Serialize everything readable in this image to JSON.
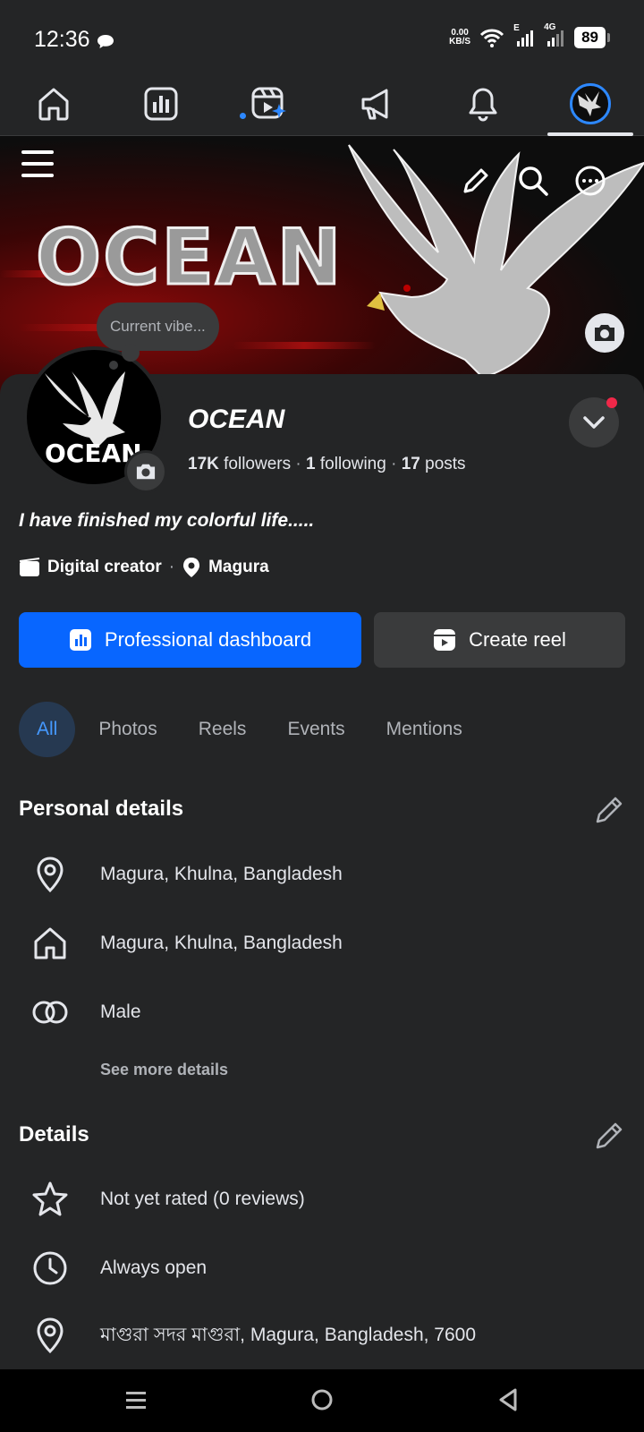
{
  "status_bar": {
    "time": "12:36",
    "net_speed_top": "0.00",
    "net_speed_bottom": "KB/S",
    "network_e": "E",
    "network_4g": "4G",
    "battery": "89"
  },
  "top_nav": {
    "items": [
      "home-icon",
      "dashboard-icon",
      "reels-icon",
      "megaphone-icon",
      "bell-icon",
      "profile-avatar"
    ],
    "active": "profile-avatar"
  },
  "cover": {
    "title": "OCEAN"
  },
  "status_bubble": "Current vibe...",
  "profile": {
    "avatar_text": "OCEAN",
    "name": "OCEAN",
    "followers_count": "17K",
    "followers_label": "followers",
    "following_count": "1",
    "following_label": "following",
    "posts_count": "17",
    "posts_label": "posts",
    "bio": "I have finished my colorful life.....",
    "category": "Digital creator",
    "location": "Magura"
  },
  "actions": {
    "primary": "Professional dashboard",
    "secondary": "Create reel"
  },
  "filters": [
    "All",
    "Photos",
    "Reels",
    "Events",
    "Mentions"
  ],
  "active_filter": "All",
  "personal_details": {
    "title": "Personal details",
    "rows": [
      {
        "icon": "location-pin-icon",
        "text": "Magura, Khulna, Bangladesh"
      },
      {
        "icon": "home-icon",
        "text": "Magura, Khulna, Bangladesh"
      },
      {
        "icon": "gender-icon",
        "text": "Male"
      }
    ],
    "see_more": "See more details"
  },
  "details": {
    "title": "Details",
    "rows": [
      {
        "icon": "star-icon",
        "text": "Not yet rated (0 reviews)"
      },
      {
        "icon": "clock-icon",
        "text": "Always open"
      },
      {
        "icon": "location-pin-icon",
        "text": "মাগুরা সদর মাগুরা, Magura, Bangladesh, 7600"
      }
    ]
  },
  "colors": {
    "background": "#242526",
    "accent": "#0866ff",
    "chip_active_bg": "#263951",
    "chip_active_text": "#4599ff",
    "notification": "#f02849"
  }
}
